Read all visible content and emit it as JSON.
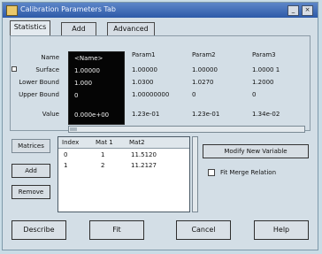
{
  "window": {
    "title": "Calibration Parameters Tab"
  },
  "tabs": [
    {
      "label": "Statistics"
    },
    {
      "label": "Add"
    },
    {
      "label": "Advanced"
    }
  ],
  "grid": {
    "row_labels": [
      "Name",
      "Surface",
      "Lower Bound",
      "Upper Bound",
      "Value"
    ],
    "columns": [
      {
        "header": "",
        "values": [
          "<Name>",
          "1.00000",
          "1.000",
          "0",
          "0.000e+00"
        ]
      },
      {
        "header": "Param1",
        "values": [
          "",
          "1.00000",
          "1.0300",
          "1.00000000",
          "1.23e-01"
        ]
      },
      {
        "header": "Param2",
        "values": [
          "",
          "1.00000",
          "1.0270",
          "0",
          "1.23e-01"
        ]
      },
      {
        "header": "Param3",
        "values": [
          "",
          "1.0000 1",
          "1.2000",
          "0",
          "1.34e-02"
        ]
      }
    ]
  },
  "side_buttons": {
    "top_label": "Matrices",
    "add_label": "Add",
    "remove_label": "Remove"
  },
  "list": {
    "headers": [
      "Index",
      "Mat 1",
      "Mat2"
    ],
    "rows": [
      [
        "0",
        "1",
        "11.5120"
      ],
      [
        "1",
        "2",
        "11.2127"
      ]
    ]
  },
  "modify_button": {
    "label": "Modify New Variable"
  },
  "checkbox": {
    "label": "Fit Merge Relation",
    "checked": false
  },
  "bottom_buttons": [
    {
      "label": "Describe"
    },
    {
      "label": "Fit"
    },
    {
      "label": "Cancel"
    },
    {
      "label": "Help"
    }
  ]
}
